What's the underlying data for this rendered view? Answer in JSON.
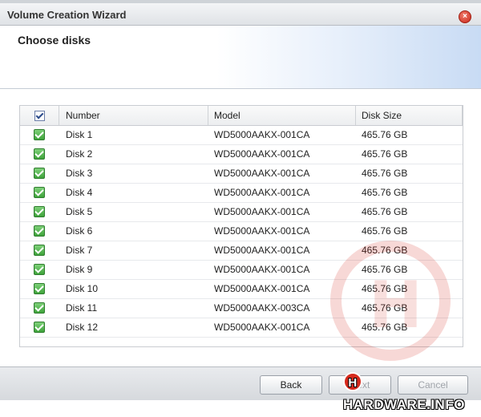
{
  "window": {
    "title": "Volume Creation Wizard",
    "close_icon": "close-icon"
  },
  "header": {
    "title": "Choose disks"
  },
  "table": {
    "columns": [
      "Number",
      "Model",
      "Disk Size"
    ],
    "rows": [
      {
        "number": "Disk 1",
        "model": "WD5000AAKX-001CA",
        "size": "465.76 GB",
        "checked": true
      },
      {
        "number": "Disk 2",
        "model": "WD5000AAKX-001CA",
        "size": "465.76 GB",
        "checked": true
      },
      {
        "number": "Disk 3",
        "model": "WD5000AAKX-001CA",
        "size": "465.76 GB",
        "checked": true
      },
      {
        "number": "Disk 4",
        "model": "WD5000AAKX-001CA",
        "size": "465.76 GB",
        "checked": true
      },
      {
        "number": "Disk 5",
        "model": "WD5000AAKX-001CA",
        "size": "465.76 GB",
        "checked": true
      },
      {
        "number": "Disk 6",
        "model": "WD5000AAKX-001CA",
        "size": "465.76 GB",
        "checked": true
      },
      {
        "number": "Disk 7",
        "model": "WD5000AAKX-001CA",
        "size": "465.76 GB",
        "checked": true
      },
      {
        "number": "Disk 9",
        "model": "WD5000AAKX-001CA",
        "size": "465.76 GB",
        "checked": true
      },
      {
        "number": "Disk 10",
        "model": "WD5000AAKX-001CA",
        "size": "465.76 GB",
        "checked": true
      },
      {
        "number": "Disk 11",
        "model": "WD5000AAKX-003CA",
        "size": "465.76 GB",
        "checked": true
      },
      {
        "number": "Disk 12",
        "model": "WD5000AAKX-001CA",
        "size": "465.76 GB",
        "checked": true
      }
    ]
  },
  "footer": {
    "back_label": "Back",
    "next_label": "Next",
    "cancel_label": "Cancel"
  },
  "watermark": {
    "logo_letter": "H",
    "logo_text": "HARDWARE.INFO"
  },
  "colors": {
    "check_green": "#3ea33a",
    "close_red": "#c9271a",
    "header_blue": "#c8dbf4"
  }
}
